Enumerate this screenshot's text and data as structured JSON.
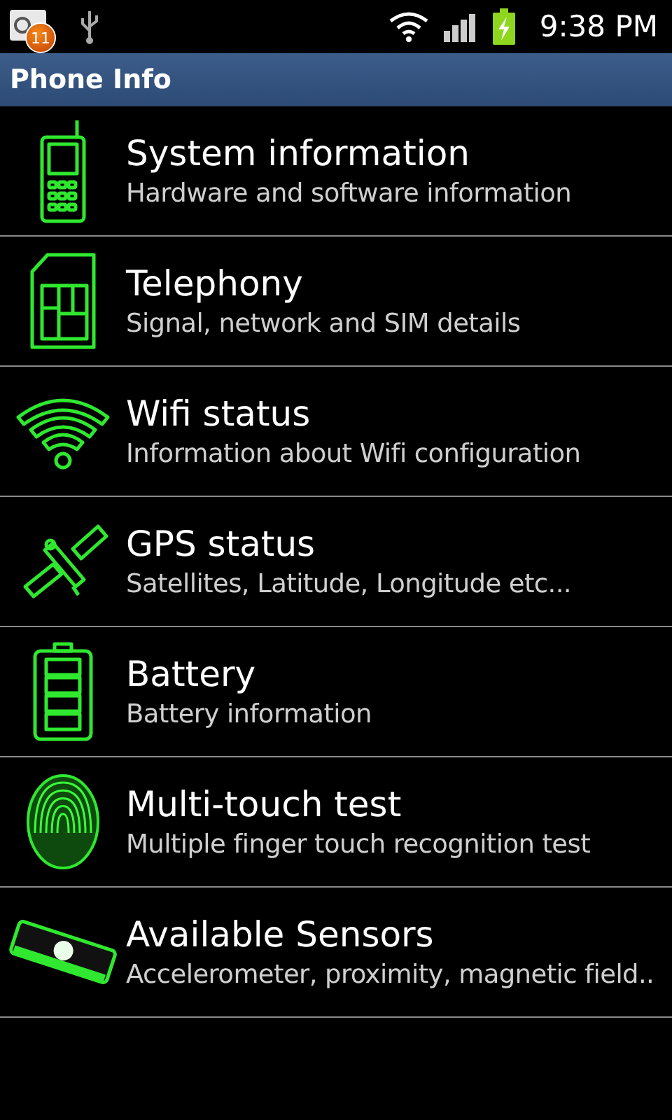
{
  "status_bar": {
    "notification_count": "11",
    "time": "9:38 PM"
  },
  "title_bar": {
    "title": "Phone Info"
  },
  "items": [
    {
      "kind": "phone",
      "title": "System information",
      "subtitle": "Hardware and software information"
    },
    {
      "kind": "sim",
      "title": "Telephony",
      "subtitle": "Signal, network and SIM details"
    },
    {
      "kind": "wifi",
      "title": "Wifi status",
      "subtitle": "Information about Wifi configuration"
    },
    {
      "kind": "satellite",
      "title": "GPS status",
      "subtitle": "Satellites, Latitude, Longitude etc..."
    },
    {
      "kind": "battery",
      "title": "Battery",
      "subtitle": "Battery information"
    },
    {
      "kind": "fingerprint",
      "title": "Multi-touch test",
      "subtitle": "Multiple finger touch recognition test"
    },
    {
      "kind": "chip",
      "title": "Available Sensors",
      "subtitle": "Accelerometer, proximity, magnetic field.."
    }
  ]
}
